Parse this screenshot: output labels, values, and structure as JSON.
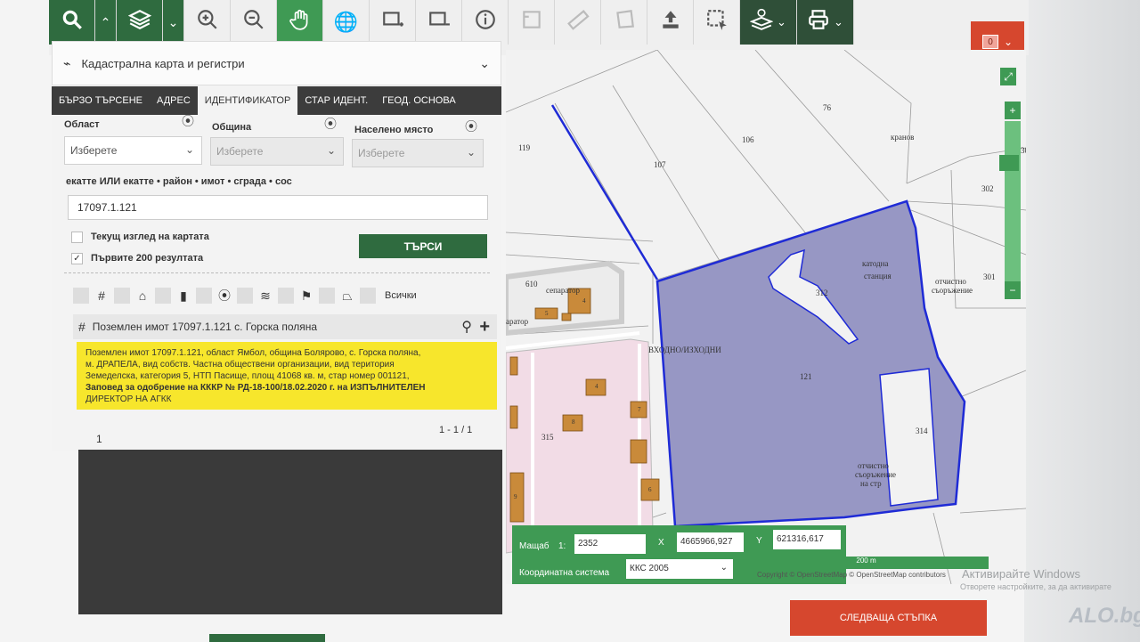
{
  "toolbar": {
    "icons": [
      "search-icon",
      "chevron-up-icon",
      "layers-icon",
      "chevron-down-icon",
      "zoom-in-icon",
      "zoom-out-icon",
      "pan-hand-icon",
      "globe-icon",
      "select-rectangle-icon",
      "select-rectangle-alt-icon",
      "info-icon",
      "measure-area-icon",
      "ruler-icon",
      "polygon-icon",
      "upload-icon",
      "select-dashed-icon",
      "identify-layers-icon",
      "print-icon"
    ]
  },
  "notification": {
    "count": "0"
  },
  "layer_selector": {
    "label": "Кадастрална карта и регистри"
  },
  "tabs": [
    {
      "label": "БЪРЗО ТЪРСЕНЕ"
    },
    {
      "label": "АДРЕС"
    },
    {
      "label": "ИДЕНТИФИКАТОР"
    },
    {
      "label": "СТАР ИДЕНТ."
    },
    {
      "label": "ГЕОД. ОСНОВА"
    }
  ],
  "form": {
    "oblast_label": "Област",
    "oblast_value": "Изберете",
    "obshtina_label": "Община",
    "obshtina_value": "Изберете",
    "naseleno_label": "Населено място",
    "naseleno_value": "Изберете",
    "ekatte_label": "екатте ИЛИ екатте • район • имот • сграда • сос",
    "ekatte_value": "17097.1.121",
    "current_view_label": "Текущ изглед на картата",
    "first200_label": "Първите 200 резултата",
    "search_button": "ТЪРСИ",
    "filter_all": "Всички"
  },
  "result": {
    "title": "Поземлен имот 17097.1.121 с. Горска поляна",
    "note_line1": "Поземлен имот 17097.1.121, област Ямбол, община Болярово, с. Горска поляна,",
    "note_line2": "м. ДРАПЕЛА, вид собств. Частна обществени организации, вид територия",
    "note_line3": "Земеделска, категория 5, НТП Пасище, площ 41068 кв. м, стар номер 001121,",
    "note_line4": "Заповед за одобрение на КККР № РД-18-100/18.02.2020 г. на ИЗПЪЛНИТЕЛЕН",
    "note_line5": "ДИРЕКТОР НА АГКК",
    "page": "1",
    "range": "1 - 1 / 1"
  },
  "map": {
    "labels": {
      "p119": "119",
      "p107": "107",
      "p106": "106",
      "p76": "76",
      "kranov": "кранов",
      "p302": "302",
      "p301": "301",
      "p30": "30",
      "p610": "610",
      "separator": "сепаратор",
      "separator2": "аратор",
      "katodna": "катодна",
      "stancia": "станция",
      "otchistno": "отчистно",
      "sorajenie": "съоръжение",
      "p312": "312",
      "vhodno": "ВХОДНО/ИЗХОДНИ",
      "p121": "121",
      "p314": "314",
      "otch2_1": "отчистно",
      "otch2_2": "съоръжение",
      "otch2_3": "на стр",
      "p315": "315",
      "b4": "4",
      "b5": "5",
      "b7": "7",
      "b8": "8",
      "b6": "6",
      "b9": "9",
      "b4b": "4"
    }
  },
  "coords": {
    "scale_label": "Мащаб",
    "scale_prefix": "1:",
    "scale_value": "2352",
    "x_label": "X",
    "x_value": "4665966,927",
    "y_label": "Y",
    "y_value": "621316,617",
    "system_label": "Координатна система",
    "system_value": "ККС 2005"
  },
  "scalebar": {
    "label": "200 m"
  },
  "attribution": "Copyright © OpenStreetMap © OpenStreetMap contributors",
  "windows": {
    "line1": "Активирайте Windows",
    "line2": "Отворете настройките, за да активирате"
  },
  "next_button": "СЛЕДВАЩА СТЪПКА",
  "logo": "ALO.bg"
}
